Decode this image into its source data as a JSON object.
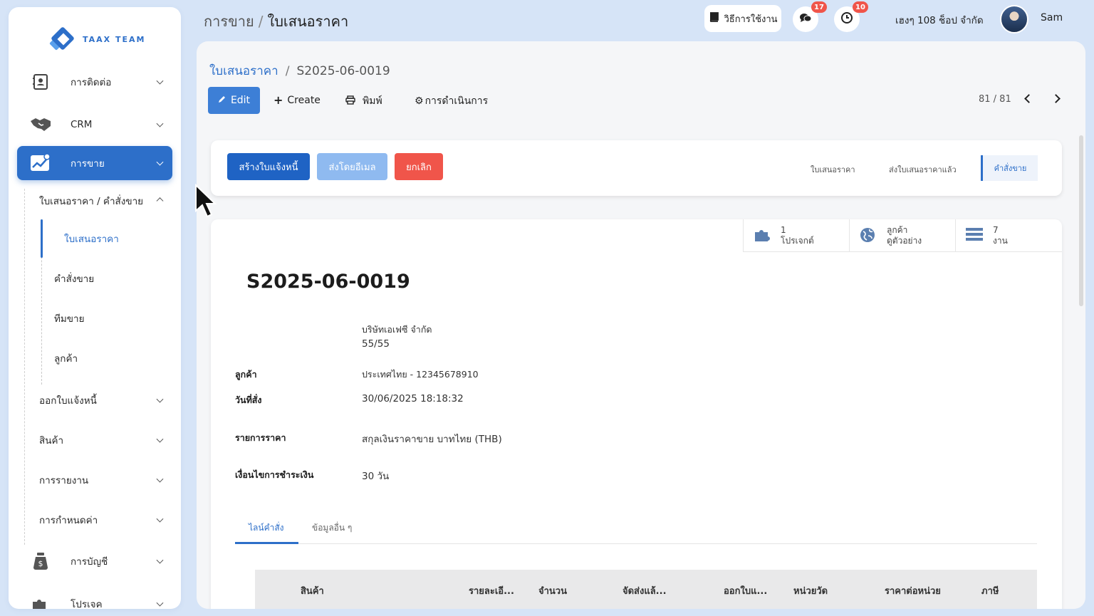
{
  "brand": {
    "name": "TAAX TEAM"
  },
  "topbar": {
    "module": "การขาย",
    "page": "ใบเสนอราคา",
    "guide_label": "วิธีการใช้งาน",
    "messages_count": "17",
    "activities_count": "10",
    "company": "เฮงๆ 108 ช็อป จำกัด",
    "user": "Sam"
  },
  "sidebar": {
    "items": [
      {
        "label": "การติดต่อ"
      },
      {
        "label": "CRM"
      },
      {
        "label": "การขาย"
      }
    ],
    "submenu_title": "ใบเสนอราคา / คำสั่งขาย",
    "submenu": [
      {
        "label": "ใบเสนอราคา"
      },
      {
        "label": "คำสั่งขาย"
      },
      {
        "label": "ทีมขาย"
      },
      {
        "label": "ลูกค้า"
      }
    ],
    "more": [
      {
        "label": "ออกใบแจ้งหนี้"
      },
      {
        "label": "สินค้า"
      },
      {
        "label": "การรายงาน"
      },
      {
        "label": "การกำหนดค่า"
      }
    ],
    "bottom": [
      {
        "label": "การบัญชี"
      },
      {
        "label": "โปรเจค"
      }
    ]
  },
  "breadcrumb": {
    "parent": "ใบเสนอราคา",
    "current": "S2025-06-0019"
  },
  "toolbar": {
    "edit": "Edit",
    "create": "Create",
    "print": "พิมพ์",
    "action": "การดำเนินการ",
    "pager": "81 / 81"
  },
  "status": {
    "create_invoice": "สร้างใบแจ้งหนี้",
    "send_email": "ส่งโดยอีเมล",
    "cancel": "ยกเลิก",
    "stages": [
      "ใบเสนอราคา",
      "ส่งใบเสนอราคาแล้ว",
      "คำสั่งขาย"
    ],
    "active_stage": "คำสั่งขาย"
  },
  "smart_buttons": [
    {
      "line1": "1",
      "line2": "โปรเจกต์"
    },
    {
      "line1": "ลูกค้า",
      "line2": "ดูตัวอย่าง"
    },
    {
      "line1": "7",
      "line2": "งาน"
    }
  ],
  "document": {
    "number": "S2025-06-0019",
    "customer_name": "บริษัทเอเฟซี จำกัด",
    "customer_address": "55/55",
    "customer_label": "ลูกค้า",
    "customer_country": "ประเทศไทย - 12345678910",
    "order_date_label": "วันที่สั่ง",
    "order_date": "30/06/2025 18:18:32",
    "pricelist_label": "รายการราคา",
    "pricelist": "สกุลเงินราคาขาย บาทไทย (THB)",
    "payment_terms_label": "เงื่อนไขการชำระเงิน",
    "payment_terms": "30 วัน"
  },
  "tabs": [
    "ไลน์คำสั่ง",
    "ข้อมูลอื่น ๆ"
  ],
  "table": {
    "columns": [
      "สินค้า",
      "รายละเอี...",
      "จำนวน",
      "จัดส่งแล้...",
      "ออกใบแ...",
      "หน่วยวัด",
      "ราคาต่อหน่วย",
      "ภาษี"
    ]
  },
  "colors": {
    "primary": "#2d6fc9",
    "danger": "#f0554a",
    "secondary": "#8fbaf0"
  }
}
